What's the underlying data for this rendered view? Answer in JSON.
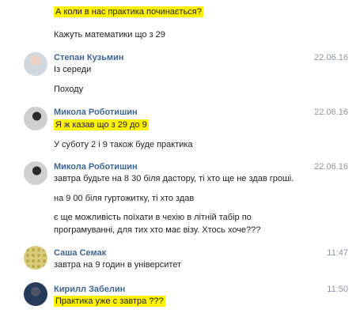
{
  "messages": [
    {
      "text": "А коли в нас практика починається?",
      "highlighted": true
    },
    {
      "text": "Кажуть математики що з 29"
    },
    {
      "author": "Степан Кузьмин",
      "date": "22.06.16",
      "avatar": "avatar-photo"
    },
    {
      "text": "Із середи"
    },
    {
      "text": "Походу"
    },
    {
      "author": "Микола Роботишин",
      "date": "22.06.16",
      "avatar": "avatar-photo"
    },
    {
      "text": "Я ж казав що з 29 до 9",
      "highlighted": true
    },
    {
      "text": "У суботу 2 і 9 також буде практика"
    },
    {
      "author": "Микола Роботишин",
      "date": "22.06.16",
      "avatar": "avatar-photo"
    },
    {
      "text": "завтра будьте на 8 30 біля дастору, ті хто ще не здав гроші."
    },
    {
      "text": "на 9 00 біля гуртожитку, ті хто здав"
    },
    {
      "text": "є ще можливість поїхати в чехію в літній табір по"
    },
    {
      "text": "програмуванні, для тих хто має візу. Хтось хоче???"
    },
    {
      "author": "Саша Семак",
      "date": "11:47",
      "avatar": "avatar-pattern"
    },
    {
      "text": "завтра на 9 годин в університет"
    },
    {
      "author": "Кирилл Забелин",
      "date": "11:50",
      "avatar": "avatar-photo"
    },
    {
      "text": "Практика уже с завтра ???",
      "highlighted": true
    }
  ],
  "colors": {
    "author": "#3d6690",
    "highlight": "#fff200",
    "timestamp": "#8b95a2",
    "text": "#222222"
  }
}
